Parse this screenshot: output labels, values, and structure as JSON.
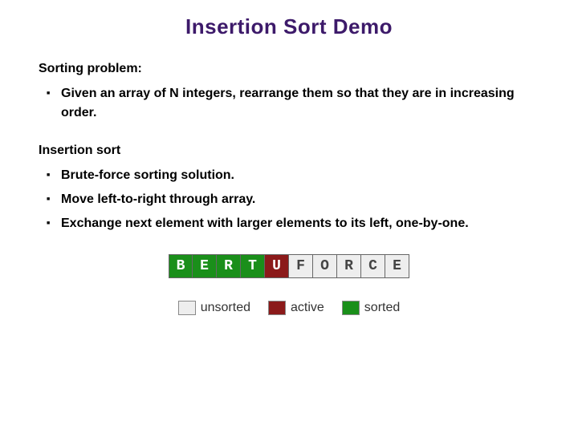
{
  "title": "Insertion Sort Demo",
  "section1": {
    "heading": "Sorting problem:",
    "bullets": [
      "Given an array of N integers, rearrange them so that they are in increasing order."
    ]
  },
  "section2": {
    "heading": "Insertion sort",
    "bullets": [
      "Brute-force sorting solution.",
      "Move left-to-right through array.",
      "Exchange next element with larger elements to its left, one-by-one."
    ]
  },
  "array": [
    {
      "letter": "B",
      "state": "sorted"
    },
    {
      "letter": "E",
      "state": "sorted"
    },
    {
      "letter": "R",
      "state": "sorted"
    },
    {
      "letter": "T",
      "state": "sorted"
    },
    {
      "letter": "U",
      "state": "active"
    },
    {
      "letter": "F",
      "state": "unsorted"
    },
    {
      "letter": "O",
      "state": "unsorted"
    },
    {
      "letter": "R",
      "state": "unsorted"
    },
    {
      "letter": "C",
      "state": "unsorted"
    },
    {
      "letter": "E",
      "state": "unsorted"
    }
  ],
  "legend": {
    "unsorted": "unsorted",
    "active": "active",
    "sorted": "sorted"
  }
}
